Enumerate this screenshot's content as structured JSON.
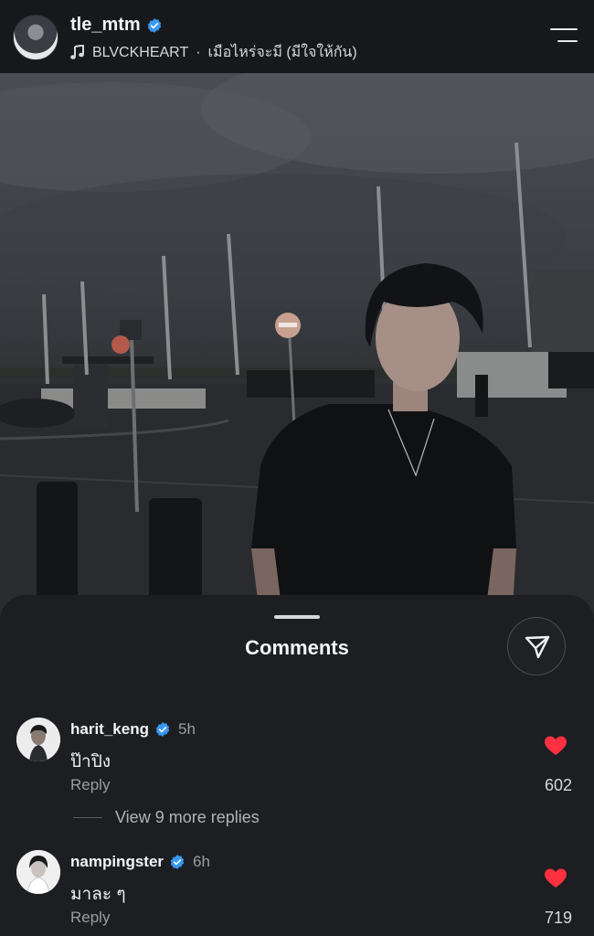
{
  "header": {
    "username": "tle_mtm",
    "music_artist": "BLVCKHEART",
    "music_separator": "·",
    "music_song": "เมือไหร่จะมี (มีใจให้กัน)"
  },
  "comments_sheet": {
    "title": "Comments",
    "comments": [
      {
        "username": "harit_keng",
        "verified": true,
        "time": "5h",
        "text": "ป๊าปิง",
        "reply_label": "Reply",
        "likes": "602",
        "view_more_label": "View 9 more replies"
      },
      {
        "username": "nampingster",
        "verified": true,
        "time": "6h",
        "text": "มาละ ๆ",
        "reply_label": "Reply",
        "likes": "719"
      }
    ]
  },
  "colors": {
    "background": "#1c1e22",
    "verified_blue": "#3897f0",
    "like_red": "#ff3040"
  },
  "icons": {
    "verified": "verified-badge-icon",
    "music": "music-note-icon",
    "menu": "menu-icon",
    "share": "send-icon",
    "like": "heart-icon"
  }
}
